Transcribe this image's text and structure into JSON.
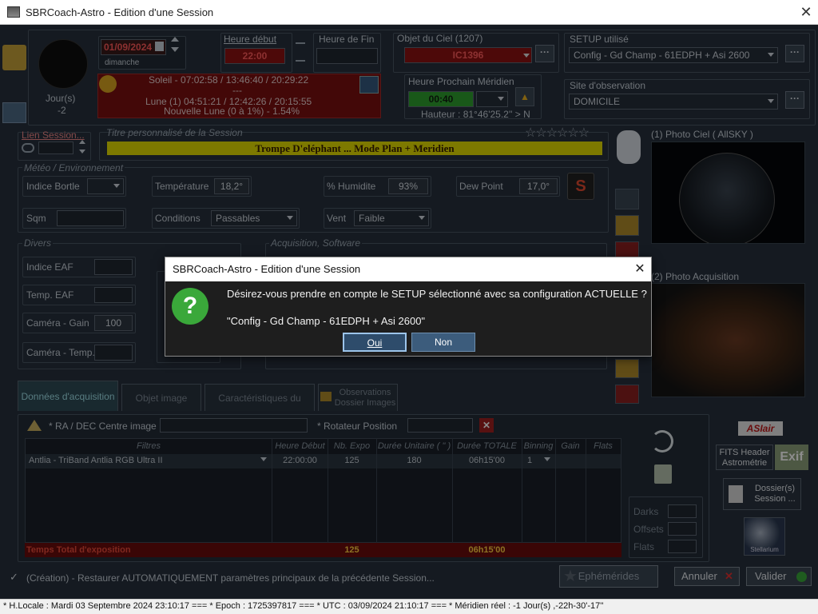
{
  "window": {
    "title": "SBRCoach-Astro - Edition d'une Session",
    "close": "✕"
  },
  "top": {
    "moon_days_label": "Jour(s)",
    "moon_days_value": "-2",
    "date_value": "01/09/2024",
    "weekday": "dimanche",
    "heure_debut_label": "Heure début",
    "heure_debut_value": "22:00",
    "heure_fin_label": "Heure de Fin",
    "heure_fin_value": "",
    "objet_label": "Objet du Ciel (1207)",
    "objet_value": "IC1396",
    "setup_label": "SETUP utilisé",
    "setup_value": "Config - Gd Champ - 61EDPH + Asi 2600",
    "soleil": "Soleil - 07:02:58 / 13:46:40 / 20:29:22",
    "sep": "---",
    "lune": "Lune (1) 04:51:21 / 12:42:26 / 20:15:55",
    "nouvelle_lune": "Nouvelle Lune (0 à 1%) - 1.54%",
    "meridien_label": "Heure Prochain Méridien",
    "meridien_value": "00:40",
    "hauteur": "Hauteur : 81°46'25.2'' > N",
    "site_label": "Site d'observation",
    "site_value": "DOMICILE",
    "ellipsis": "···"
  },
  "session": {
    "lien_label": "Lien Session...",
    "titre_label": "Titre personnalisé de la Session",
    "titre_value": "Trompe D'eléphant ... Mode Plan + Meridien",
    "stars": "☆☆☆☆☆☆"
  },
  "meteo": {
    "group_label": "Météo / Environnement",
    "bortle_label": "Indice Bortle",
    "temp_label": "Température",
    "temp_value": "18,2°",
    "hum_label": "% Humidite",
    "hum_value": "93%",
    "dew_label": "Dew Point",
    "dew_value": "17,0°",
    "sqm_label": "Sqm",
    "cond_label": "Conditions",
    "cond_value": "Passables",
    "vent_label": "Vent",
    "vent_value": "Faible"
  },
  "divers": {
    "group_label": "Divers",
    "eaf_label": "Indice EAF",
    "teaf_label": "Temp. EAF",
    "gain_label": "Caméra - Gain",
    "gain_value": "100",
    "ctemp_label": "Caméra - Temp.",
    "acq_label": "Acquisition, Software"
  },
  "photos": {
    "ciel_label": "(1) Photo Ciel ( AllSKY )",
    "acq_label": "(2) Photo Acquisition"
  },
  "tabs": [
    {
      "label": "Données d'acquisition"
    },
    {
      "label": "Objet image"
    },
    {
      "label": "Caractéristiques du Setup"
    },
    {
      "label": "Observations\nDossier Images"
    }
  ],
  "acq": {
    "radec_label": "* RA / DEC Centre image",
    "rot_label": "* Rotateur Position",
    "headers": [
      "Filtres",
      "Heure Début",
      "Nb. Expo",
      "Durée Unitaire ( \" )",
      "Durée TOTALE",
      "Binning",
      "Gain",
      "Flats"
    ],
    "row": [
      "Antlia - TriBand Antlia RGB Ultra II",
      "22:00:00",
      "125",
      "180",
      "06h15'00",
      "1",
      "",
      ""
    ],
    "total_label": "Temps Total d'exposition",
    "total_expo": "125",
    "total_duree": "06h15'00",
    "darks": "Darks",
    "offsets": "Offsets",
    "flats": "Flats"
  },
  "right": {
    "asiair": "ASIair",
    "fits": "FITS Header\nAstrométrie",
    "exif": "Exif",
    "dossiers": "Dossier(s)\nSession ...",
    "stellarium": "Stellarium"
  },
  "bottom": {
    "restore": "(Création) - Restaurer AUTOMATIQUEMENT paramètres principaux de la précédente Session...",
    "ephem": "Ephémérides",
    "annuler": "Annuler",
    "valider": "Valider"
  },
  "status": "* H.Locale : Mardi 03 Septembre 2024 23:10:17  ===  * Epoch : 1725397817  ===  * UTC : 03/09/2024 21:10:17  ===  * Méridien réel : -1 Jour(s) ,-22h-30'-17''",
  "dialog": {
    "title": "SBRCoach-Astro - Edition d'une Session",
    "close": "✕",
    "icon": "?",
    "message": "Désirez-vous prendre en compte le SETUP sélectionné avec sa configuration ACTUELLE ?",
    "setup": "\"Config - Gd Champ - 61EDPH + Asi 2600\"",
    "oui": "Oui",
    "non": "Non"
  },
  "colors": {
    "accent_red": "#8c1111",
    "accent_green": "#2ea12e",
    "title_yellow": "#e8e000",
    "dialog_bg": "#1e1e1e"
  }
}
